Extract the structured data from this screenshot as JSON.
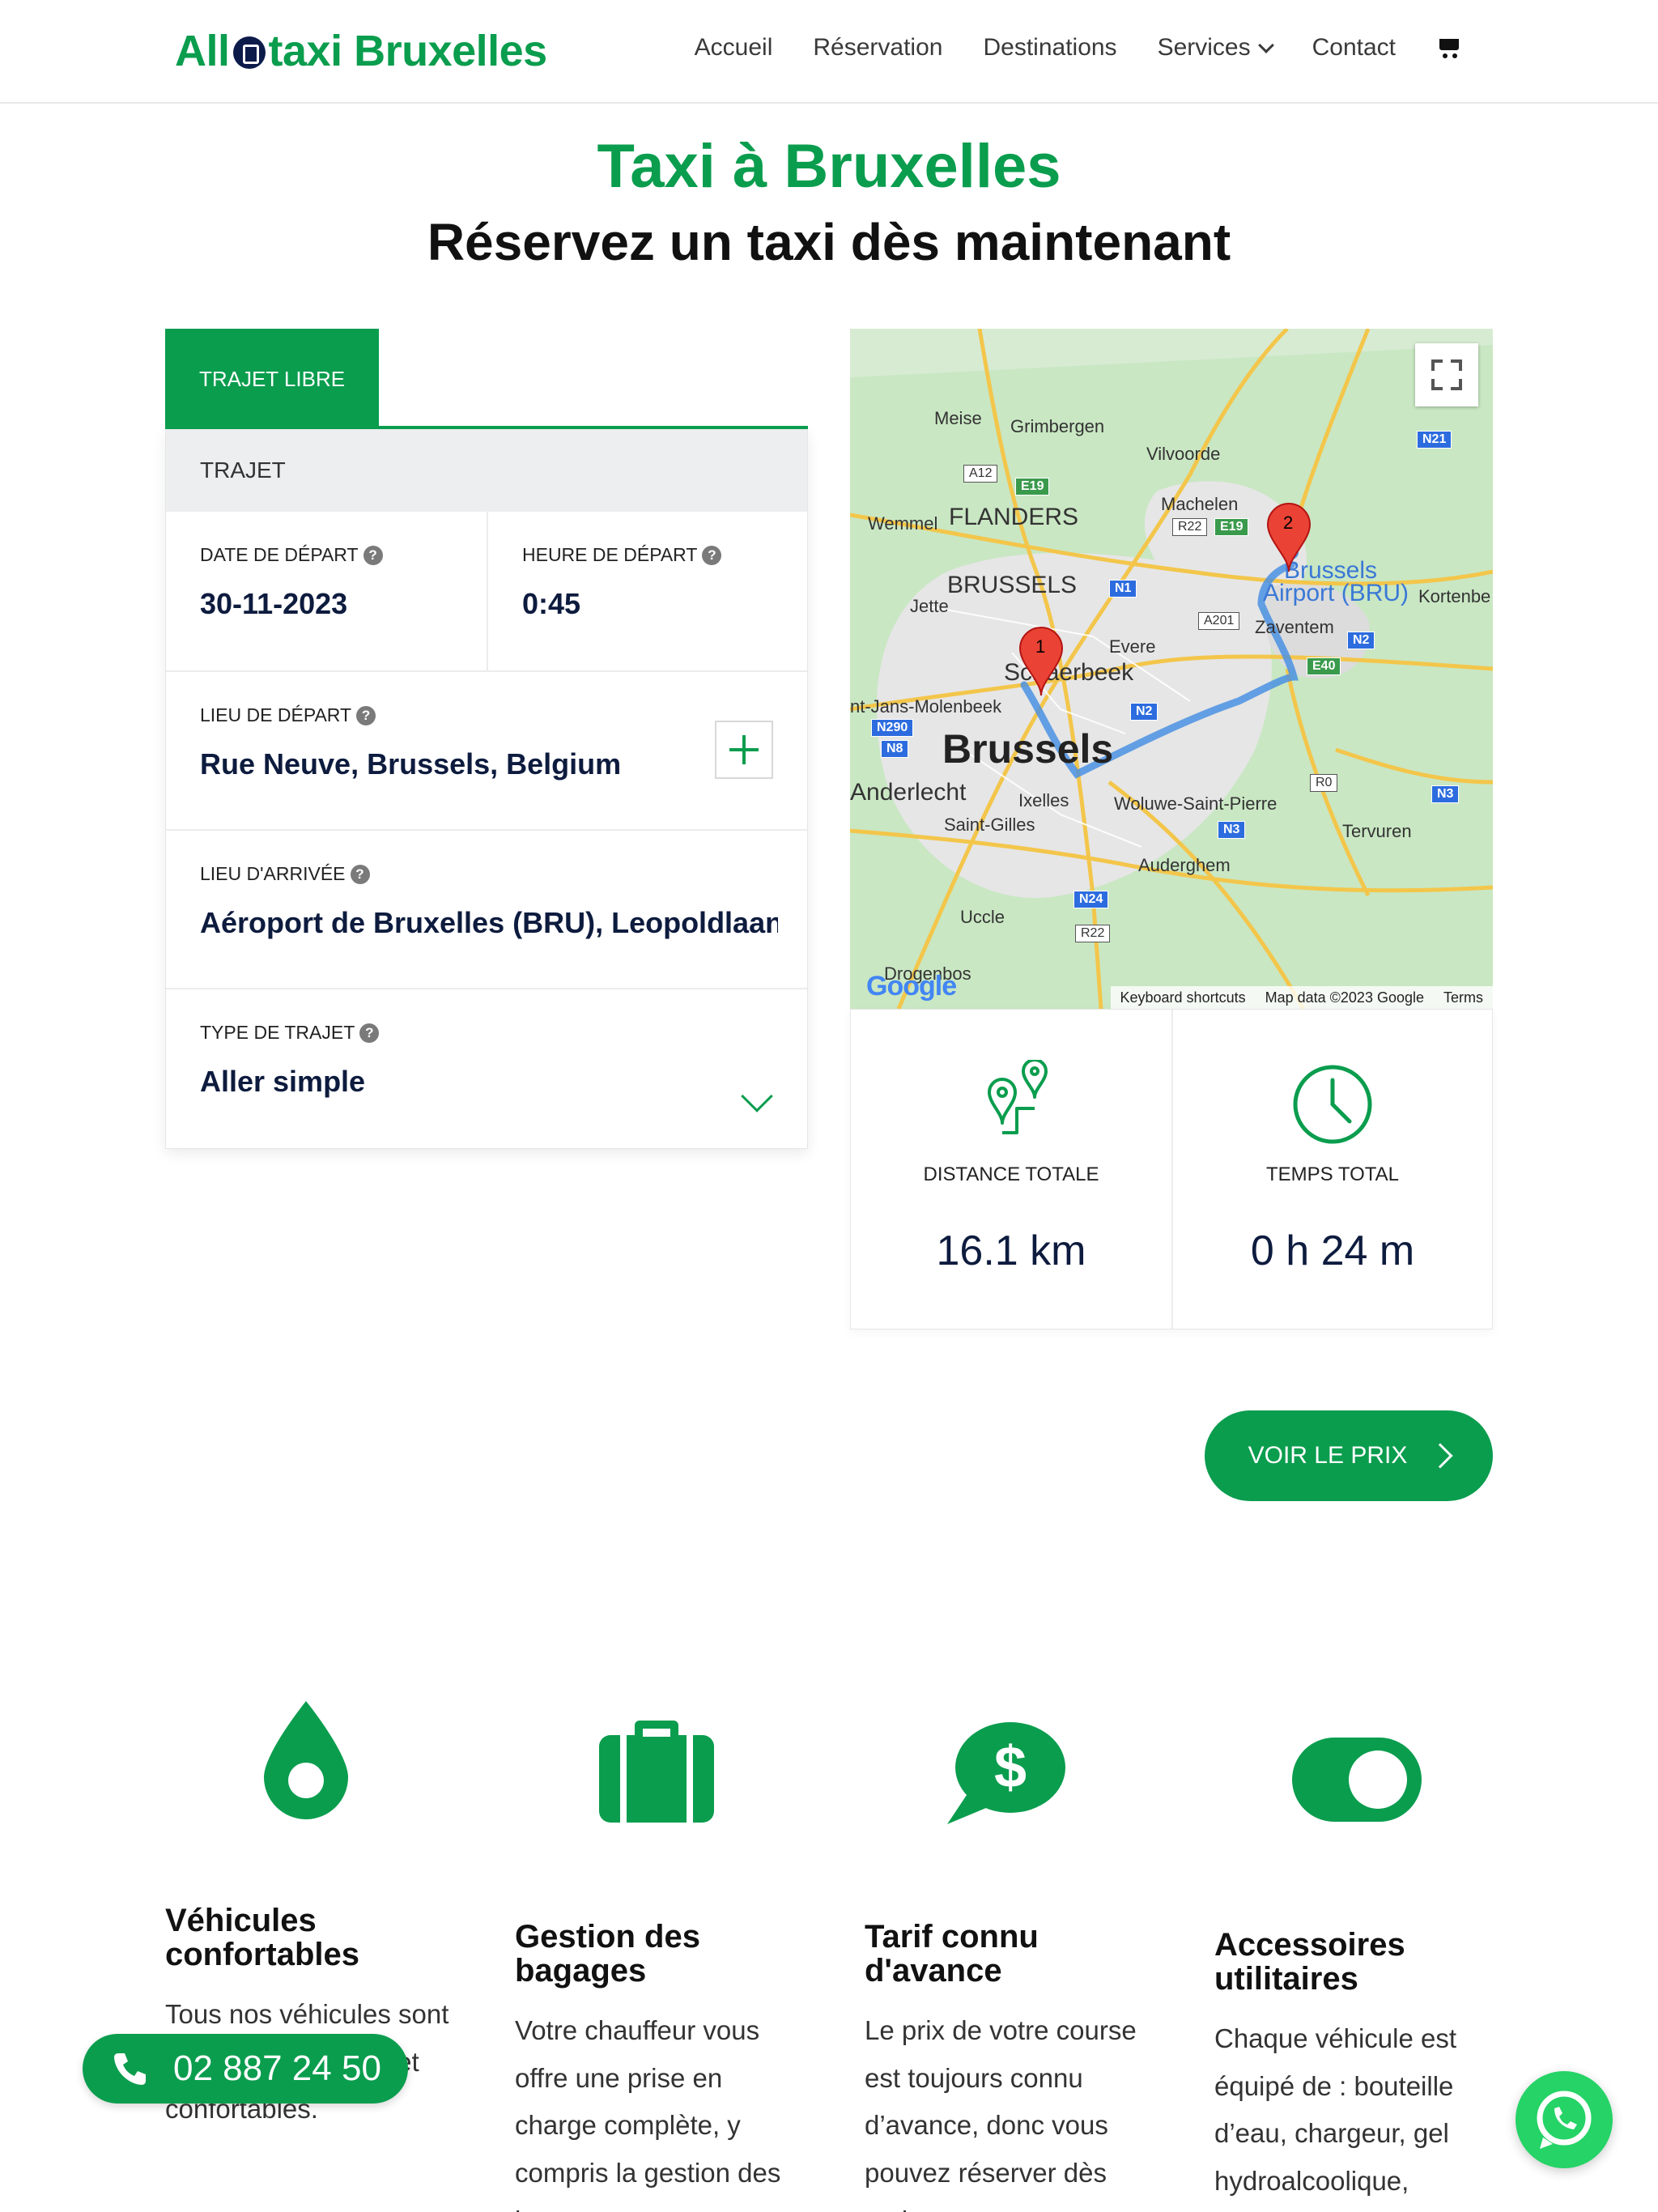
{
  "header": {
    "logo_left": "All",
    "logo_right": "taxi Bruxelles",
    "nav": [
      "Accueil",
      "Réservation",
      "Destinations",
      "Services",
      "Contact"
    ]
  },
  "hero": {
    "title": "Taxi à Bruxelles",
    "subtitle": "Réservez un taxi dès maintenant"
  },
  "form": {
    "tab": "TRAJET LIBRE",
    "section": "TRAJET",
    "date_label": "DATE DE DÉPART",
    "date_value": "30-11-2023",
    "time_label": "HEURE DE DÉPART",
    "time_value": "0:45",
    "from_label": "LIEU DE DÉPART",
    "from_value": "Rue Neuve, Brussels, Belgium",
    "to_label": "LIEU D'ARRIVÉE",
    "to_value": "Aéroport de Bruxelles (BRU), Leopoldlaan, Zaventem",
    "type_label": "TYPE DE TRAJET",
    "type_value": "Aller simple",
    "help": "?"
  },
  "map": {
    "labels": {
      "meise": "Meise",
      "grimbergen": "Grimbergen",
      "vilvoorde": "Vilvoorde",
      "wemmel": "Wemmel",
      "flanders": "FLANDERS",
      "machelen": "Machelen",
      "brussels_region": "BRUSSELS",
      "jette": "Jette",
      "airport1": "Brussels",
      "airport2": "Airport (BRU)",
      "kortenberg": "Kortenbe",
      "zaventem": "Zaventem",
      "evere": "Evere",
      "schaerbeek": "Schaerbeek",
      "molenbeek": "nt-Jans-Molenbeek",
      "brussels": "Brussels",
      "anderlecht": "Anderlecht",
      "ixelles": "Ixelles",
      "woluwe": "Woluwe-Saint-Pierre",
      "saintgilles": "Saint-Gilles",
      "tervuren": "Tervuren",
      "auderghem": "Auderghem",
      "uccle": "Uccle",
      "drogenbos": "Drogenbos"
    },
    "roads": [
      "A12",
      "E19",
      "R22",
      "E19",
      "N1",
      "A201",
      "N2",
      "E40",
      "N2",
      "N290",
      "N8",
      "R0",
      "N3",
      "N3",
      "N24",
      "R22",
      "N21"
    ],
    "marker_a": "1",
    "marker_b": "2",
    "google": "Google",
    "shortcuts": "Keyboard shortcuts",
    "mapdata": "Map data ©2023 Google",
    "terms": "Terms"
  },
  "stats": {
    "distance_label": "DISTANCE TOTALE",
    "distance_value": "16.1 km",
    "time_label": "TEMPS TOTAL",
    "time_value": "0 h 24 m"
  },
  "cta": "VOIR LE PRIX",
  "features": [
    {
      "title": "Véhicules confortables",
      "text": "Tous nos véhicules sont modernes, propres et confortables."
    },
    {
      "title": "Gestion des bagages",
      "text": "Votre chauffeur vous offre une prise en charge complète, y compris la gestion des bagages."
    },
    {
      "title": "Tarif connu d'avance",
      "text": "Le prix de votre course est toujours connu d’avance, donc vous pouvez réserver dès maintenant."
    },
    {
      "title": "Accessoires utilitaires",
      "text": "Chaque véhicule est équipé de : bouteille d’eau, chargeur, gel hydroalcoolique, friandise..."
    }
  ],
  "phone": "02 887 24 50",
  "colors": {
    "brand": "#0a9d4e",
    "dark": "#0d1b3e",
    "whatsapp": "#25d366"
  }
}
